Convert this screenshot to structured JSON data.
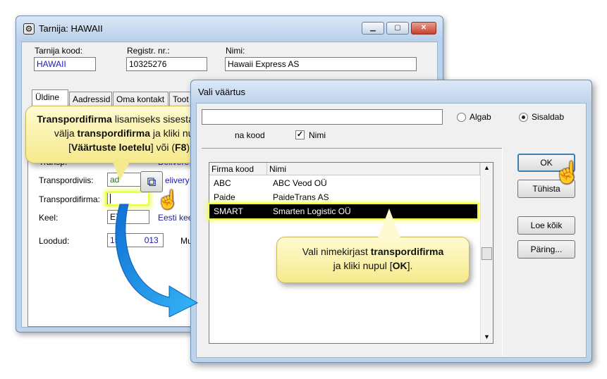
{
  "supplier_window": {
    "title": "Tarnija: HAWAII",
    "fields": {
      "code_label": "Tarnija kood:",
      "code_value": "HAWAII",
      "regnr_label": "Registr. nr.:",
      "regnr_value": "10325276",
      "name_label": "Nimi:",
      "name_value": "Hawaii Express AS"
    },
    "tabs": [
      "Üldine",
      "Aadressid",
      "Oma kontakt",
      "Toot"
    ],
    "rows": {
      "transp_label": "Transp.",
      "transp_value": "Delivere",
      "transportviis_label": "Transpordiviis:",
      "transportviis_value": "ad",
      "transportviis_value2": "elivery",
      "transpfirma_label": "Transpordifirma:",
      "transpfirma_value": "",
      "keel_label": "Keel:",
      "keel_value": "ET",
      "keel_value2": "Eesti kee",
      "loodud_label": "Loodud:",
      "loodud_value": "15.1",
      "loodud_value2": "013",
      "mu_label": "Mu"
    }
  },
  "select_window": {
    "title": "Vali väärtus",
    "search_value": "",
    "radio_starts": "Algab",
    "radio_contains": "Sisaldab",
    "check_code_label": "na kood",
    "check_name_label": "Nimi",
    "columns": [
      "Firma kood",
      "Nimi"
    ],
    "rows": [
      {
        "code": "ABC",
        "name": "ABC Veod OÜ"
      },
      {
        "code": "Paide",
        "name": "PaideTrans AS"
      },
      {
        "code": "SMART",
        "name": "Smarten Logistic OÜ"
      }
    ],
    "buttons": {
      "ok": "OK",
      "cancel": "Tühista",
      "read_all": "Loe kõik",
      "query": "Päring..."
    }
  },
  "callouts": {
    "left": {
      "p1_bold": "Transpordifirma",
      "p1": " lisamiseks sisesta kursor välja ",
      "p2_bold": "transpordifirma",
      "p2": " ja kliki nupul [",
      "p3_bold": "Väärtuste loetelu",
      "p3": "] või (",
      "p4_bold": "F8",
      "p4": ")."
    },
    "right": {
      "p1": "Vali nimekirjast ",
      "p1_bold": "transpordifirma",
      "p2": "ja kliki nupul [",
      "p2_bold": "OK",
      "p3": "]."
    }
  },
  "colors": {
    "highlight": "#eaff3c",
    "callout_bg": "#f6e98c",
    "arrow": "#1e90e8",
    "title_bar": "#bcd3ec"
  }
}
